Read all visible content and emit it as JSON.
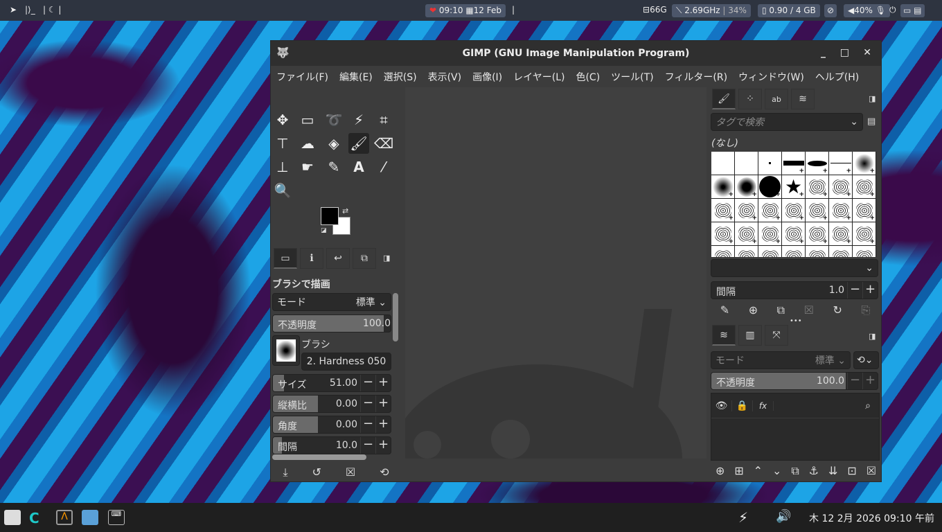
{
  "top_panel": {
    "left_icons": [
      "send-icon",
      "terminal-icon",
      "moon-icon"
    ],
    "clock": "09:10",
    "date": "12 Feb",
    "disk": "66G",
    "cpu": "2.69GHz",
    "cpu_load": "34%",
    "memory": "0.90 / 4 GB",
    "volume": "40%"
  },
  "window": {
    "title": "GIMP (GNU Image Manipulation Program)",
    "minimize": "_",
    "maximize": "□",
    "close": "✕"
  },
  "menu": [
    "ファイル(F)",
    "編集(E)",
    "選択(S)",
    "表示(V)",
    "画像(I)",
    "レイヤー(L)",
    "色(C)",
    "ツール(T)",
    "フィルター(R)",
    "ウィンドウ(W)",
    "ヘルプ(H)"
  ],
  "tool_options": {
    "title": "ブラシで描画",
    "mode_label": "モード",
    "mode_value": "標準",
    "opacity_label": "不透明度",
    "opacity_value": "100.0",
    "opacity_fraction": 1.0,
    "brush_label": "ブラシ",
    "brush_value": "2. Hardness 050",
    "params": [
      {
        "label": "サイズ",
        "value": "51.00",
        "fraction": 0.12
      },
      {
        "label": "縦横比",
        "value": "0.00",
        "fraction": 0.5
      },
      {
        "label": "角度",
        "value": "0.00",
        "fraction": 0.5
      },
      {
        "label": "間隔",
        "value": "10.0",
        "fraction": 0.1
      }
    ]
  },
  "brushes": {
    "search_placeholder": "タグで検索",
    "tag": "(なし)",
    "spacing_label": "間隔",
    "spacing_value": "1.0"
  },
  "layers": {
    "mode_label": "モード",
    "mode_value": "標準",
    "opacity_label": "不透明度",
    "opacity_value": "100.0"
  },
  "taskbar": {
    "datetime": "木 12  2月 2026 09:10 午前"
  },
  "colors": {
    "accent": "#4c566a",
    "panel": "#2e3440",
    "gimp_bg": "#3c3c3c"
  }
}
